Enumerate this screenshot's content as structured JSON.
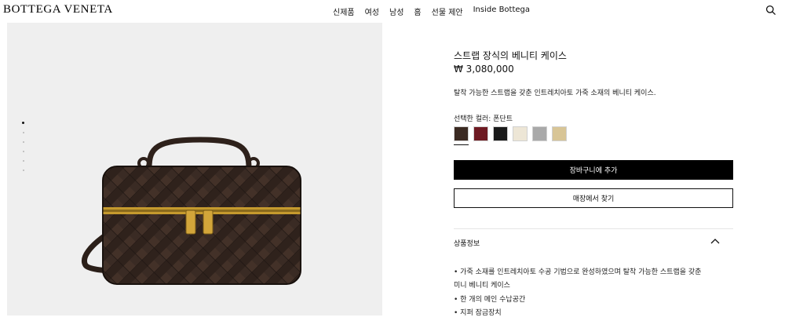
{
  "header": {
    "logo": "BOTTEGA VENETA",
    "nav": [
      "신제품",
      "여성",
      "남성",
      "홈",
      "선물 제안",
      "Inside Bottega"
    ]
  },
  "gallery": {
    "image_count": 6,
    "active_index": 0
  },
  "product": {
    "title": "스트랩 장식의 베니티 케이스",
    "price": "₩ 3,080,000",
    "description": "탈착 가능한 스트랩을 갖춘 인트레치아토 가죽 소재의 베니티 케이스.",
    "color_label": "선택한 컬러: 폰단트",
    "swatches": [
      {
        "name": "fondant",
        "color": "#3b2a22",
        "selected": true
      },
      {
        "name": "burgundy",
        "color": "#6e1a22"
      },
      {
        "name": "black",
        "color": "#1a1a1a"
      },
      {
        "name": "cream",
        "color": "#ede6d6"
      },
      {
        "name": "grey",
        "color": "#a9a9a9"
      },
      {
        "name": "beige",
        "color": "#d8c596"
      }
    ],
    "add_to_cart": "장바구니에 추가",
    "find_store": "매장에서 찾기"
  },
  "accordion": {
    "title": "상품정보",
    "lines": [
      "• 가죽 소재를 인트레치아토 수공 기법으로 완성하였으며 탈착 가능한 스트랩을 갖춘",
      "미니 베니티 케이스",
      "• 한 개의 메인 수납공간",
      "• 지퍼 잠금장치"
    ]
  }
}
